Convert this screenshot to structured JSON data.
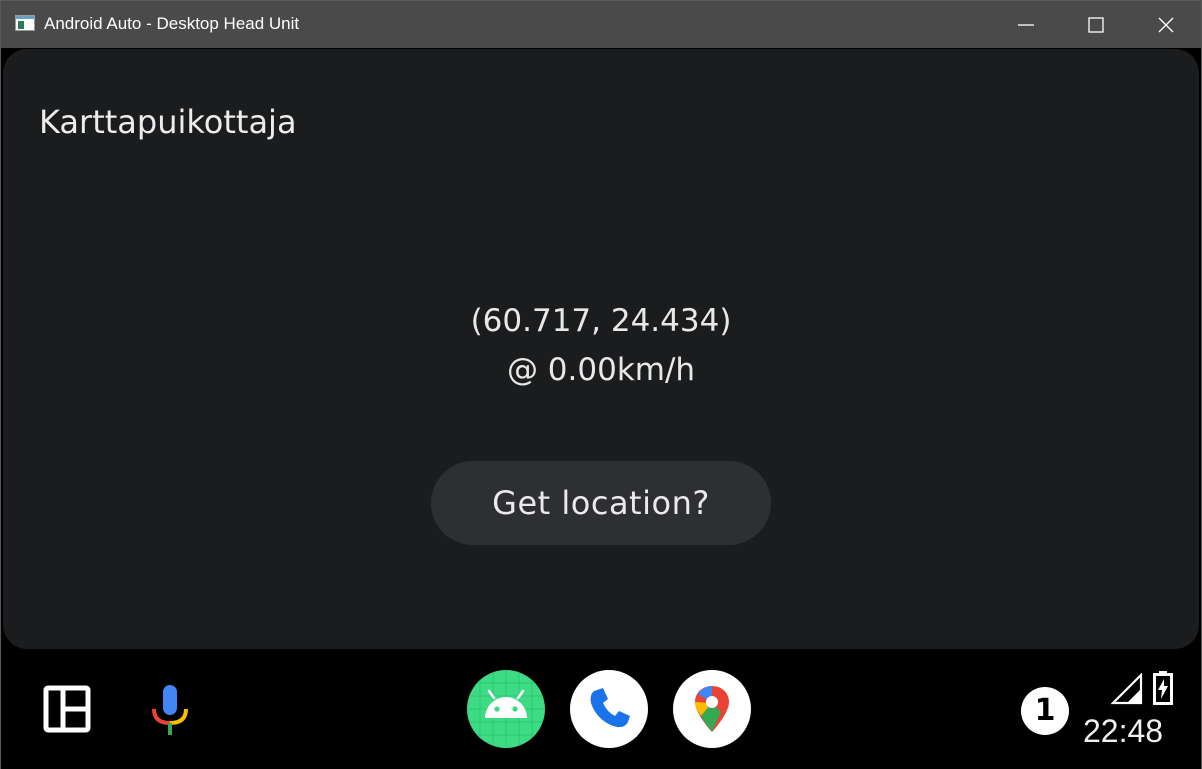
{
  "window": {
    "title": "Android Auto - Desktop Head Unit",
    "minimize_icon": "minimize-icon",
    "maximize_icon": "maximize-icon",
    "close_icon": "close-icon"
  },
  "screen": {
    "title": "Karttapuikottaja",
    "coordinates": "(60.717, 24.434)",
    "speed": "@ 0.00km/h",
    "action_button": "Get location?"
  },
  "rail": {
    "dashboard_icon": "dashboard-icon",
    "assistant_icon": "microphone-icon",
    "apps": [
      {
        "name": "android-app-icon",
        "color": "#3ddc84"
      },
      {
        "name": "phone-app-icon",
        "color": "#1a73e8"
      },
      {
        "name": "maps-app-icon",
        "color": "#34a853"
      }
    ],
    "notification_count": "1",
    "signal_icon": "signal-icon",
    "battery_icon": "battery-charging-icon",
    "time": "22:48"
  },
  "colors": {
    "card_background": "#1b1c1e",
    "button_background": "#2e2f32",
    "titlebar": "#4a4a4a"
  }
}
